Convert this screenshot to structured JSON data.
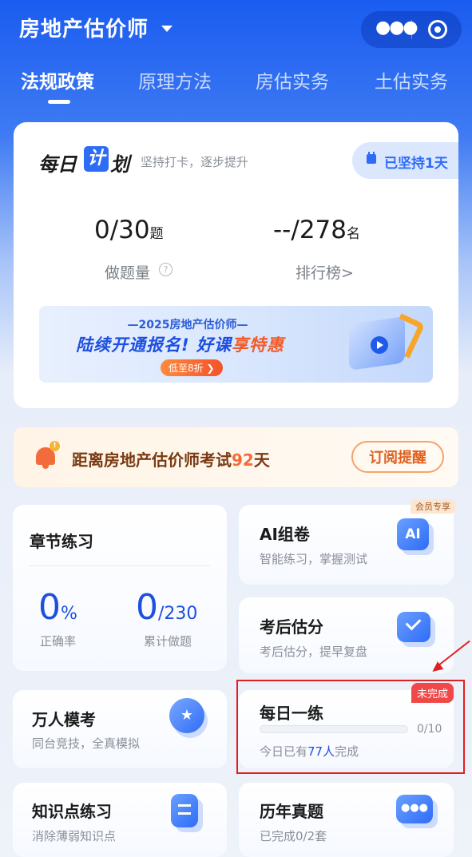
{
  "header": {
    "title": "房地产估价师",
    "tabs": [
      {
        "label": "法规政策",
        "active": true
      },
      {
        "label": "原理方法",
        "active": false
      },
      {
        "label": "房估实务",
        "active": false
      },
      {
        "label": "土估实务",
        "active": false
      }
    ],
    "more_icon": "more-dots-icon",
    "close_icon": "target-icon"
  },
  "plan": {
    "title_a": "每日",
    "title_b": "计",
    "title_c": "划",
    "subtitle": "坚持打卡，逐步提升",
    "streak": "已坚持1天",
    "done_value": "0/30",
    "done_unit": "题",
    "done_label": "做题量",
    "rank_value": "--/278",
    "rank_unit": "名",
    "rank_label": "排行榜>"
  },
  "banner": {
    "line1": "—2025房地产估价师—",
    "line2_a": "陆续开通报名! 好课",
    "line2_b": "享特惠",
    "pill": "低至8折 ❯"
  },
  "countdown": {
    "text_a": "距离房地产估价师考试",
    "days": "92",
    "text_b": "天",
    "subscribe": "订阅提醒"
  },
  "tiles": {
    "chapter": {
      "title": "章节练习",
      "accuracy": "0",
      "accuracy_unit": "%",
      "accuracy_label": "正确率",
      "done": "0",
      "done_total": "/230",
      "done_label": "累计做题"
    },
    "ai": {
      "title": "AI组卷",
      "sub": "智能练习，掌握测试",
      "badge": "会员专享",
      "icon_text": "AI"
    },
    "estimate": {
      "title": "考后估分",
      "sub": "考后估分，提早复盘"
    },
    "mock": {
      "title": "万人模考",
      "sub": "同台竞技，全真模拟"
    },
    "daily": {
      "title": "每日一练",
      "status": "未完成",
      "progress_text": "0/10",
      "progress": 0.0,
      "sub_a": "今日已有",
      "sub_num": "77人",
      "sub_b": "完成"
    },
    "knowledge": {
      "title": "知识点练习",
      "sub": "消除薄弱知识点"
    },
    "past": {
      "title": "历年真题",
      "sub": "已完成0/2套"
    }
  },
  "colors": {
    "accent": "#2e6cf6",
    "warning": "#f26b3a",
    "alert": "#e02020"
  }
}
